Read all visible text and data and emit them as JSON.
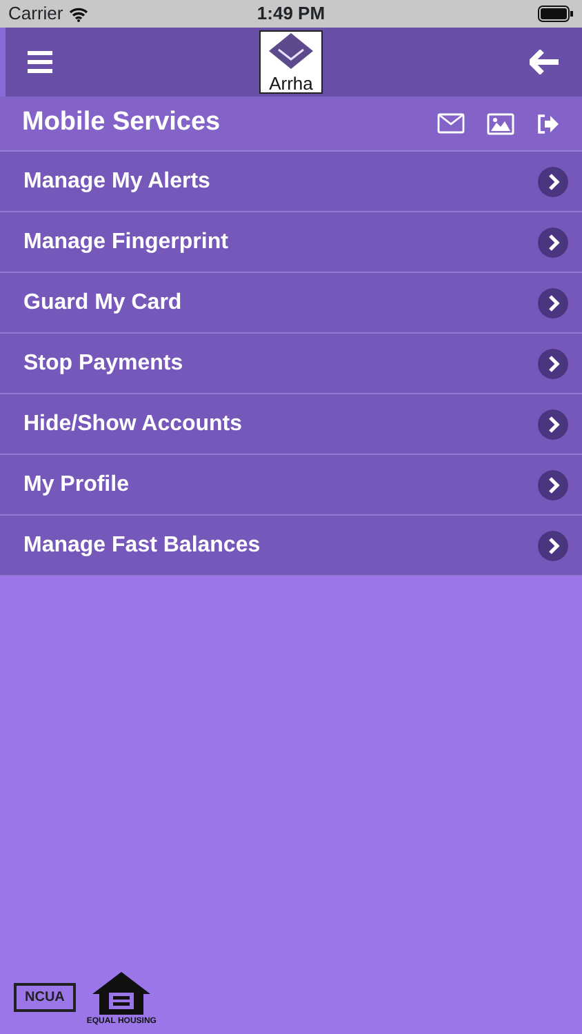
{
  "status_bar": {
    "carrier": "Carrier",
    "time": "1:49 PM"
  },
  "header": {
    "logo_text": "Arrha"
  },
  "section": {
    "title": "Mobile Services"
  },
  "menu_items": [
    {
      "label": "Manage My Alerts"
    },
    {
      "label": "Manage Fingerprint"
    },
    {
      "label": "Guard My Card"
    },
    {
      "label": "Stop Payments"
    },
    {
      "label": "Hide/Show Accounts"
    },
    {
      "label": "My Profile"
    },
    {
      "label": "Manage Fast Balances"
    }
  ],
  "footer": {
    "ncua": "NCUA",
    "housing": "EQUAL HOUSING"
  }
}
